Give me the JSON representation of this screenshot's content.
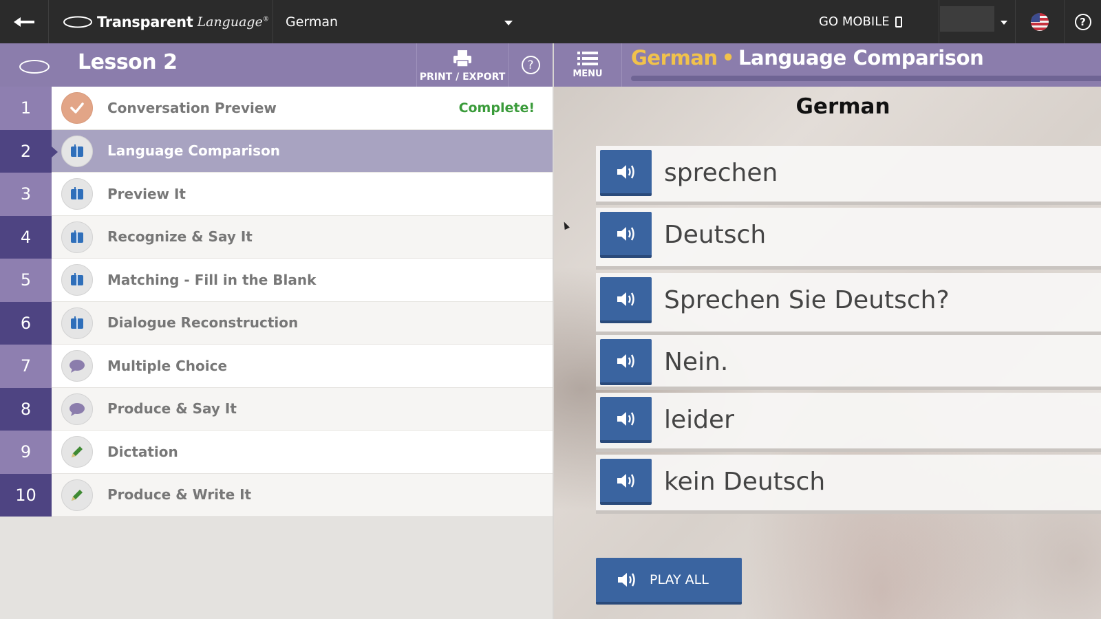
{
  "topbar": {
    "brand_main": "Transparent",
    "brand_sub": "Language",
    "brand_reg": "®",
    "language": "German",
    "go_mobile": "GO MOBILE",
    "help": "?"
  },
  "lesson": {
    "title": "Lesson 2",
    "print_label": "PRINT / EXPORT",
    "help": "?"
  },
  "activities": [
    {
      "num": "1",
      "label": "Conversation Preview",
      "status": "Complete!",
      "icon": "check-icon"
    },
    {
      "num": "2",
      "label": "Language Comparison",
      "status": "",
      "icon": "book-icon"
    },
    {
      "num": "3",
      "label": "Preview It",
      "status": "",
      "icon": "book-icon"
    },
    {
      "num": "4",
      "label": "Recognize & Say It",
      "status": "",
      "icon": "book-icon"
    },
    {
      "num": "5",
      "label": "Matching - Fill in the Blank",
      "status": "",
      "icon": "book-icon"
    },
    {
      "num": "6",
      "label": "Dialogue Reconstruction",
      "status": "",
      "icon": "book-icon"
    },
    {
      "num": "7",
      "label": "Multiple Choice",
      "status": "",
      "icon": "speech-bubble-icon"
    },
    {
      "num": "8",
      "label": "Produce & Say It",
      "status": "",
      "icon": "speech-bubble-icon"
    },
    {
      "num": "9",
      "label": "Dictation",
      "status": "",
      "icon": "pencil-icon"
    },
    {
      "num": "10",
      "label": "Produce & Write It",
      "status": "",
      "icon": "pencil-icon"
    }
  ],
  "activity_colors": {
    "book": "#2f6fba",
    "speech": "#8b7dac",
    "pencil": "#3f8a33",
    "check_bg": "#e2a587"
  },
  "activity_ui": {
    "active_index": 1
  },
  "right": {
    "menu_label": "MENU",
    "title_lang": "German",
    "title_sep": "•",
    "title_activity": "Language Comparison",
    "column_title": "German",
    "words": [
      "sprechen",
      "Deutsch",
      "Sprechen Sie Deutsch?",
      "Nein.",
      "leider",
      "kein Deutsch"
    ],
    "play_all": "PLAY ALL"
  },
  "colors": {
    "header_purple": "#8b7dac",
    "dark_purple": "#4e4482",
    "button_blue": "#3a64a0",
    "accent_yellow": "#f1c24b",
    "complete_green": "#3a9b3a"
  }
}
